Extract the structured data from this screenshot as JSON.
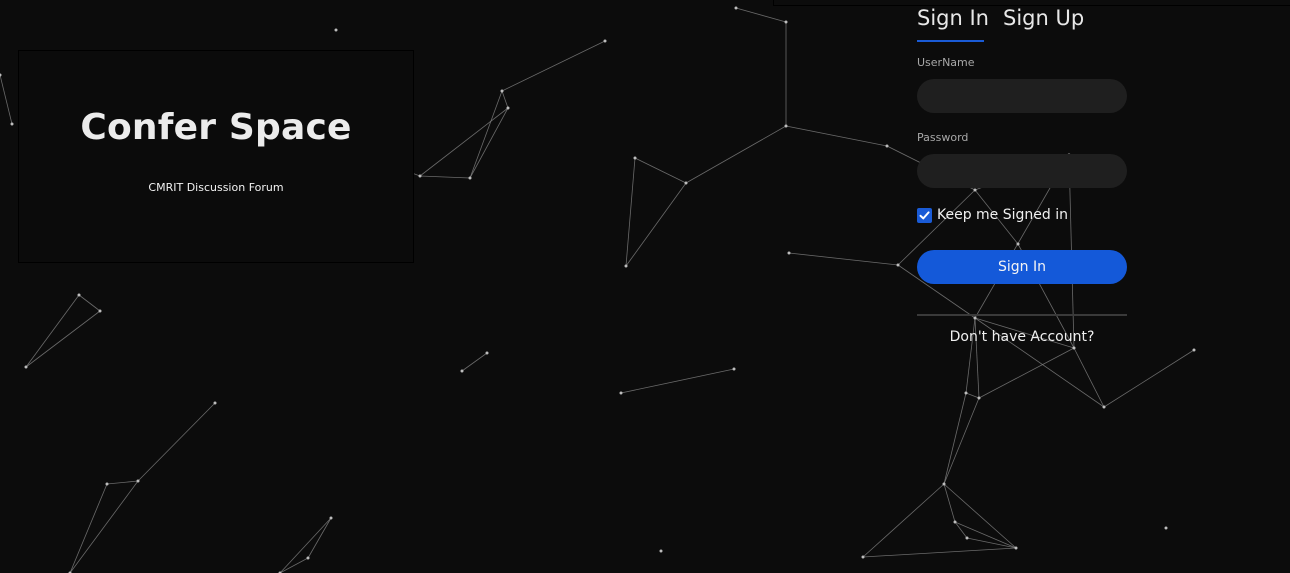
{
  "brand": {
    "title": "Confer Space",
    "subtitle": "CMRIT Discussion Forum"
  },
  "auth": {
    "tabs": [
      {
        "label": "Sign In",
        "active": true
      },
      {
        "label": "Sign Up",
        "active": false
      }
    ],
    "username_label": "UserName",
    "username_value": "",
    "password_label": "Password",
    "password_value": "",
    "keep_signed_in_label": "Keep me Signed in",
    "keep_signed_in_checked": true,
    "submit_label": "Sign In",
    "no_account_label": "Don't have Account?"
  },
  "colors": {
    "background": "#0c0c0c",
    "accent": "#1459d9",
    "field_bg": "#1f1f1f"
  }
}
